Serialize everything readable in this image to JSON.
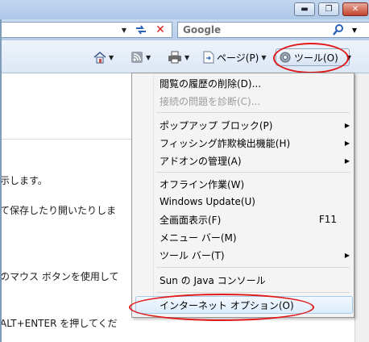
{
  "window": {
    "buttons": [
      {
        "name": "minimize",
        "glyph": "▬"
      },
      {
        "name": "maximize",
        "glyph": "❐"
      },
      {
        "name": "close",
        "glyph": "✕"
      }
    ]
  },
  "search": {
    "text": "Google"
  },
  "commandbar": {
    "page_label": "ページ(P)",
    "tools_label": "ツール(O)"
  },
  "page_lines": [
    "示します。",
    "て保存したり開いたりしま",
    "のマウス ボタンを使用して",
    "ALT+ENTER を押してくだ"
  ],
  "menu": {
    "items": [
      {
        "label": "閲覧の履歴の削除(D)...",
        "enabled": true
      },
      {
        "label": "接続の問題を診断(C)...",
        "enabled": false
      },
      {
        "label": "ポップアップ ブロック(P)",
        "submenu": true
      },
      {
        "label": "フィッシング詐欺検出機能(H)",
        "submenu": true
      },
      {
        "label": "アドオンの管理(A)",
        "submenu": true
      },
      {
        "label": "オフライン作業(W)"
      },
      {
        "label": "Windows Update(U)"
      },
      {
        "label": "全画面表示(F)",
        "shortcut": "F11"
      },
      {
        "label": "メニュー バー(M)"
      },
      {
        "label": "ツール バー(T)",
        "submenu": true
      },
      {
        "label": "Sun の Java コンソール"
      },
      {
        "label": "インターネット オプション(O)",
        "highlighted": true
      }
    ]
  },
  "annotation_color": "#e01818"
}
